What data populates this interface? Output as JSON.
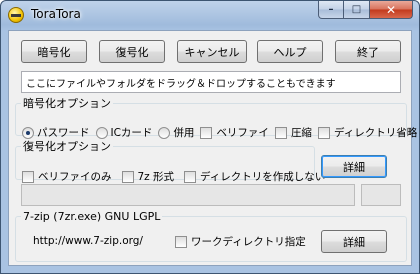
{
  "window": {
    "title": "ToraTora",
    "minimize_symbol": "–",
    "maximize_symbol": "□",
    "close_symbol": "✕"
  },
  "toolbar": {
    "encrypt_label": "暗号化",
    "decrypt_label": "復号化",
    "cancel_label": "キャンセル",
    "help_label": "ヘルプ",
    "exit_label": "終了"
  },
  "drop_area": {
    "text": "ここにファイルやフォルダをドラッグ＆ドロップすることもできます"
  },
  "encrypt_options": {
    "legend": "暗号化オプション",
    "password_label": "パスワード",
    "ic_card_label": "ICカード",
    "combined_label": "併用",
    "verify_label": "ベリファイ",
    "compress_label": "圧縮",
    "omit_directory_label": "ディレクトリ省略",
    "selected": "password"
  },
  "decrypt_options": {
    "legend": "復号化オプション",
    "verify_only_label": "ベリファイのみ",
    "seven_z_label": "7z 形式",
    "no_directory_label": "ディレクトリを作成しない",
    "details_label": "詳細"
  },
  "progress": {
    "value": 0
  },
  "footer": {
    "legend": "7-zip (7zr.exe)  GNU LGPL",
    "url": "http://www.7-zip.org/",
    "work_directory_label": "ワークディレクトリ指定",
    "details_label": "詳細"
  },
  "icons": {
    "app": "toratora-app-icon",
    "minimize": "minimize-icon",
    "maximize": "maximize-icon",
    "close": "close-icon"
  }
}
